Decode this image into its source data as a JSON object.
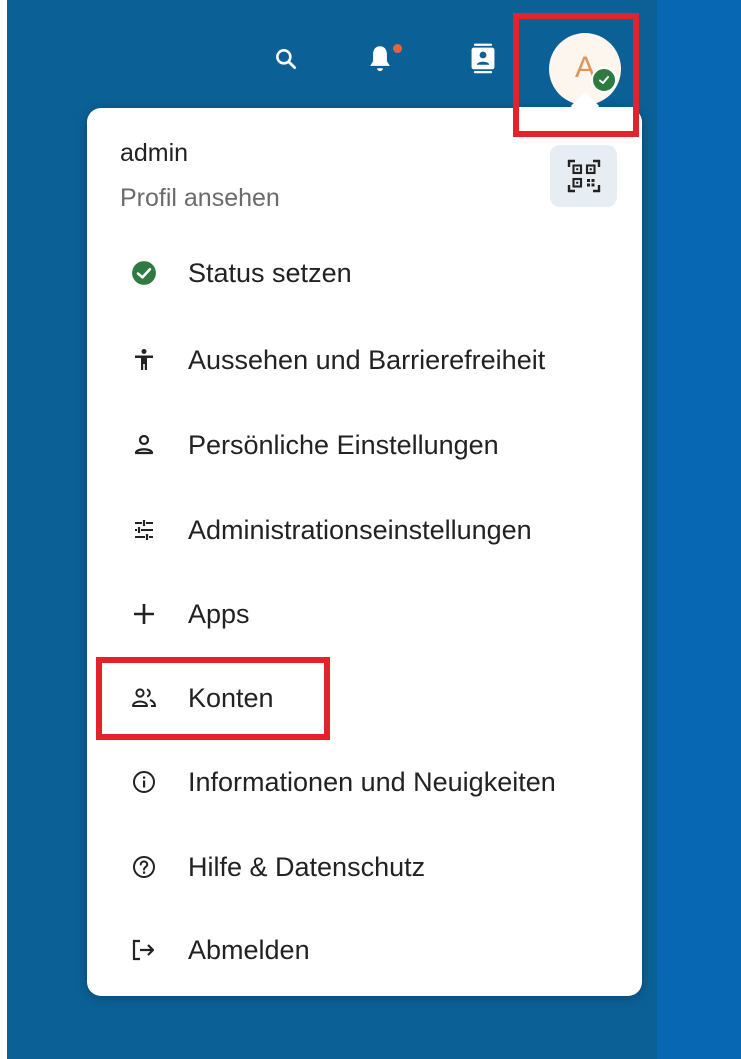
{
  "header": {
    "icons": [
      "search-icon",
      "bell-icon",
      "contacts-icon"
    ],
    "avatar_initial": "A",
    "notification_color": "#e9643a",
    "status_color": "#2d7b41"
  },
  "user_menu": {
    "username": "admin",
    "profile_link": "Profil ansehen",
    "qr_icon": "qr-code-icon",
    "items": [
      {
        "label": "Status setzen",
        "icon": "status-online-icon"
      },
      {
        "label": "Aussehen und Barrierefreiheit",
        "icon": "accessibility-icon"
      },
      {
        "label": "Persönliche Einstellungen",
        "icon": "user-icon"
      },
      {
        "label": "Administrationseinstellungen",
        "icon": "tune-icon"
      },
      {
        "label": "Apps",
        "icon": "plus-icon"
      },
      {
        "label": "Konten",
        "icon": "accounts-icon"
      },
      {
        "label": "Informationen und Neuigkeiten",
        "icon": "info-icon"
      },
      {
        "label": "Hilfe & Datenschutz",
        "icon": "help-icon"
      },
      {
        "label": "Abmelden",
        "icon": "logout-icon"
      }
    ]
  },
  "theme": {
    "header_bg": "#0b6096",
    "side_bg": "#0767b2",
    "highlight_color": "#e2232b"
  }
}
